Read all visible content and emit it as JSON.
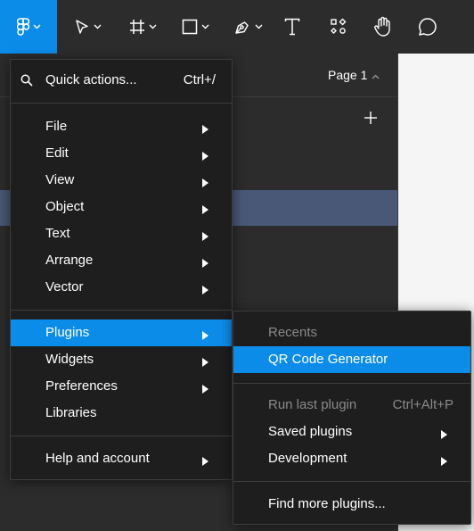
{
  "toolbar": {
    "tools": [
      {
        "name": "main-menu",
        "icon": "figma-logo-icon"
      },
      {
        "name": "move",
        "icon": "cursor-arrow-icon"
      },
      {
        "name": "frame",
        "icon": "frame-hash-icon"
      },
      {
        "name": "shape",
        "icon": "rectangle-icon"
      },
      {
        "name": "pen",
        "icon": "pen-icon"
      },
      {
        "name": "text",
        "icon": "text-T-icon"
      },
      {
        "name": "resources",
        "icon": "resources-icon"
      },
      {
        "name": "hand",
        "icon": "hand-icon"
      },
      {
        "name": "comment",
        "icon": "comment-bubble-icon"
      }
    ],
    "active_color": "#0c8ce9"
  },
  "panel": {
    "page_label": "Page 1"
  },
  "main_menu": {
    "quick_actions": {
      "label": "Quick actions...",
      "shortcut": "Ctrl+/"
    },
    "items": [
      {
        "label": "File"
      },
      {
        "label": "Edit"
      },
      {
        "label": "View"
      },
      {
        "label": "Object"
      },
      {
        "label": "Text"
      },
      {
        "label": "Arrange"
      },
      {
        "label": "Vector"
      }
    ],
    "group2": [
      {
        "label": "Plugins",
        "active": true
      },
      {
        "label": "Widgets"
      },
      {
        "label": "Preferences"
      },
      {
        "label": "Libraries"
      }
    ],
    "help": {
      "label": "Help and account"
    }
  },
  "plugins_menu": {
    "recents_header": "Recents",
    "recent_items": [
      {
        "label": "QR Code Generator",
        "active": true
      }
    ],
    "run_last": {
      "label": "Run last plugin",
      "shortcut": "Ctrl+Alt+P"
    },
    "saved": {
      "label": "Saved plugins"
    },
    "development": {
      "label": "Development"
    },
    "find_more": {
      "label": "Find more plugins..."
    }
  },
  "colors": {
    "menu_bg": "#1e1e1e",
    "highlight": "#0c8ce9",
    "selection_row": "#4a5878"
  }
}
